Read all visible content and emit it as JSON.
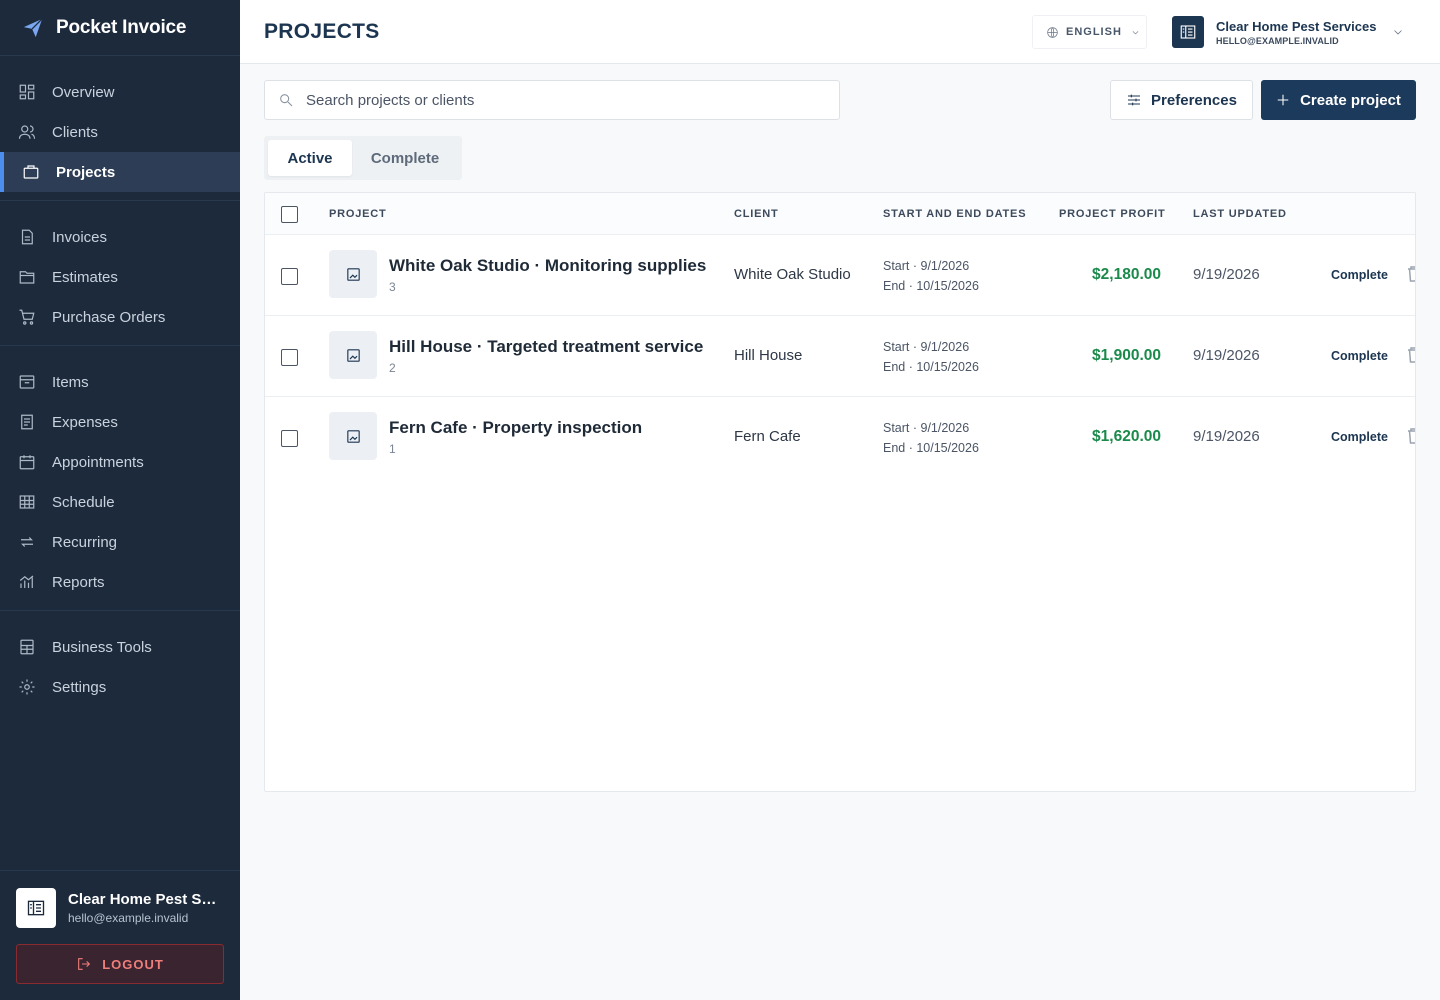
{
  "app": {
    "name": "Pocket Invoice"
  },
  "sidebar": {
    "groups": [
      [
        {
          "label": "Overview",
          "icon": "grid-icon"
        },
        {
          "label": "Clients",
          "icon": "users-icon"
        },
        {
          "label": "Projects",
          "icon": "briefcase-icon",
          "active": true
        }
      ],
      [
        {
          "label": "Invoices",
          "icon": "document-icon"
        },
        {
          "label": "Estimates",
          "icon": "folder-icon"
        },
        {
          "label": "Purchase Orders",
          "icon": "cart-icon"
        }
      ],
      [
        {
          "label": "Items",
          "icon": "box-icon"
        },
        {
          "label": "Expenses",
          "icon": "receipt-icon"
        },
        {
          "label": "Appointments",
          "icon": "calendar-icon"
        },
        {
          "label": "Schedule",
          "icon": "table-icon"
        },
        {
          "label": "Recurring",
          "icon": "repeat-icon"
        },
        {
          "label": "Reports",
          "icon": "chart-icon"
        }
      ],
      [
        {
          "label": "Business Tools",
          "icon": "calculator-icon"
        },
        {
          "label": "Settings",
          "icon": "gear-icon"
        }
      ]
    ],
    "account": {
      "name": "Clear Home Pest Services",
      "email": "hello@example.invalid",
      "logout_label": "LOGOUT"
    }
  },
  "header": {
    "title": "PROJECTS",
    "language": "ENGLISH",
    "business_name": "Clear Home Pest Services",
    "business_email": "HELLO@EXAMPLE.INVALID"
  },
  "toolbar": {
    "search_placeholder": "Search projects or clients",
    "search_value": "",
    "preferences_label": "Preferences",
    "create_label": "Create project"
  },
  "tabs": [
    {
      "label": "Active",
      "active": true
    },
    {
      "label": "Complete",
      "active": false
    }
  ],
  "table": {
    "columns": {
      "project": "PROJECT",
      "client": "CLIENT",
      "dates": "START AND END DATES",
      "profit": "PROJECT PROFIT",
      "updated": "LAST UPDATED"
    },
    "rows": [
      {
        "name": "White Oak Studio · Monitoring supplies",
        "count": "3",
        "client": "White Oak Studio",
        "start": "Start · 9/1/2026",
        "end": "End · 10/15/2026",
        "profit": "$2,180.00",
        "updated": "9/19/2026",
        "action": "Complete"
      },
      {
        "name": "Hill House · Targeted treatment service",
        "count": "2",
        "client": "Hill House",
        "start": "Start · 9/1/2026",
        "end": "End · 10/15/2026",
        "profit": "$1,900.00",
        "updated": "9/19/2026",
        "action": "Complete"
      },
      {
        "name": "Fern Cafe · Property inspection",
        "count": "1",
        "client": "Fern Cafe",
        "start": "Start · 9/1/2026",
        "end": "End · 10/15/2026",
        "profit": "$1,620.00",
        "updated": "9/19/2026",
        "action": "Complete"
      }
    ]
  },
  "colors": {
    "sidebar_bg": "#1c2a3c",
    "accent": "#4c8ef0",
    "primary_button": "#1c3a5c",
    "profit_green": "#1a8a4a",
    "logout_red": "#f07e7a"
  }
}
